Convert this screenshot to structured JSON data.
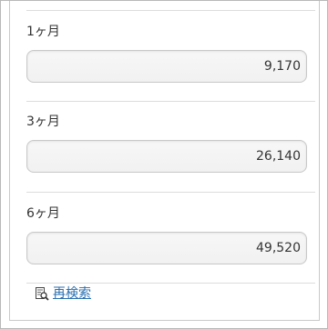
{
  "periods": [
    {
      "label": "1ヶ月",
      "value": "9,170"
    },
    {
      "label": "3ヶ月",
      "value": "26,140"
    },
    {
      "label": "6ヶ月",
      "value": "49,520"
    }
  ],
  "actions": {
    "research_label": "再検索",
    "research_icon": "search-document-icon"
  },
  "colors": {
    "link": "#2a6fb0",
    "border": "#c8c8c8",
    "field_bg": "#f4f4f4"
  }
}
